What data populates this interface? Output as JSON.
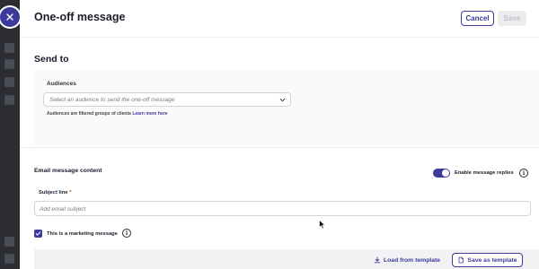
{
  "header": {
    "title": "One-off message",
    "cancel_label": "Cancel",
    "save_label": "Save"
  },
  "send_to": {
    "title": "Send to",
    "audiences_label": "Audiences",
    "audience_placeholder": "Select an audience to send the one-off message",
    "help_text": "Audiences are filtered groups of clients",
    "help_link": "Learn more here"
  },
  "email": {
    "title": "Email message content",
    "enable_replies_label": "Enable message replies",
    "enable_replies_on": true,
    "subject_label": "Subject line",
    "subject_required_mark": "*",
    "subject_placeholder": "Add email subject",
    "marketing_label": "This is a marketing message",
    "marketing_checked": true
  },
  "template_bar": {
    "load_label": "Load from template",
    "save_label": "Save as template"
  },
  "icons": {
    "close": "close-icon",
    "chevron": "chevron-down-icon",
    "info": "info-icon",
    "download": "download-icon",
    "document": "document-icon"
  },
  "colors": {
    "accent": "#3c3a9a",
    "rail": "#2b2d33",
    "disabled_bg": "#ececef"
  }
}
